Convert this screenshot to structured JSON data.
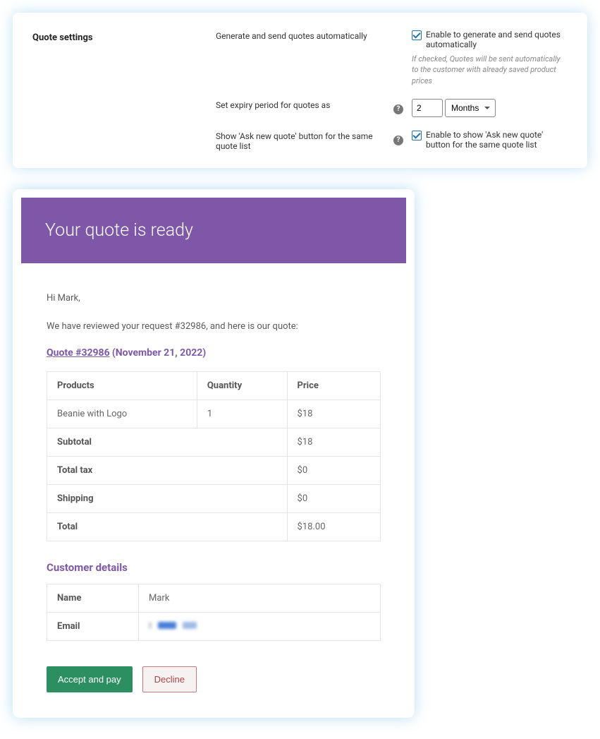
{
  "settings": {
    "title": "Quote settings",
    "rows": {
      "auto_send": {
        "label": "Generate and send quotes automatically",
        "checkbox_label": "Enable to generate and send quotes automatically",
        "hint": "If checked, Quotes will be sent automatically to the customer with already saved product prices"
      },
      "expiry": {
        "label": "Set expiry period for quotes as",
        "value": "2",
        "unit": "Months"
      },
      "ask_new": {
        "label": "Show 'Ask new quote' button for the same quote list",
        "checkbox_label": "Enable to show 'Ask new quote' button for the same quote list"
      }
    }
  },
  "email": {
    "header": "Your quote is ready",
    "greeting": "Hi Mark,",
    "intro": "We have reviewed your request #32986, and here is our quote:",
    "quote_link": "Quote #32986",
    "quote_date": "(November 21, 2022)",
    "table": {
      "headers": {
        "products": "Products",
        "quantity": "Quantity",
        "price": "Price"
      },
      "item": {
        "name": "Beanie with Logo",
        "qty": "1",
        "price": "$18"
      },
      "subtotal_label": "Subtotal",
      "subtotal_value": "$18",
      "tax_label": "Total tax",
      "tax_value": "$0",
      "shipping_label": "Shipping",
      "shipping_value": "$0",
      "total_label": "Total",
      "total_value": "$18.00"
    },
    "customer": {
      "heading": "Customer details",
      "name_label": "Name",
      "name_value": "Mark",
      "email_label": "Email"
    },
    "buttons": {
      "accept": "Accept and pay",
      "decline": "Decline"
    }
  }
}
